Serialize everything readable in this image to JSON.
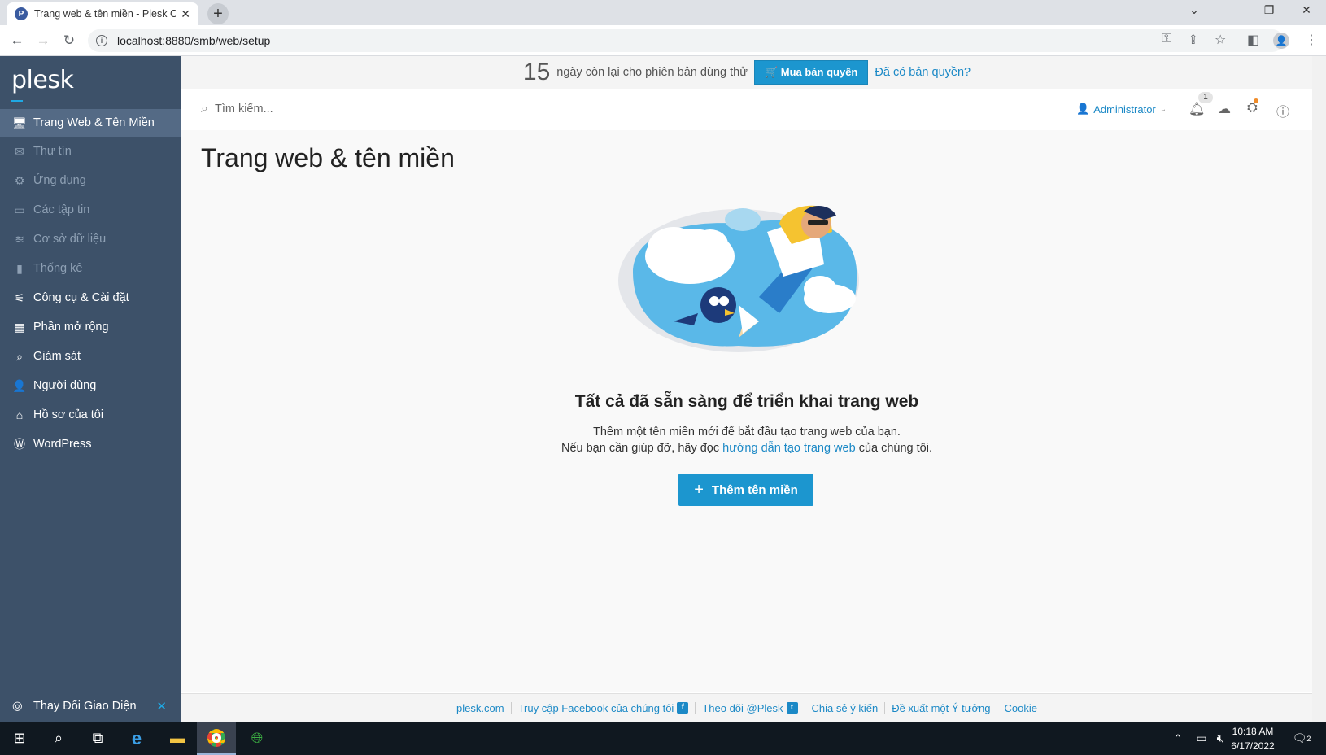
{
  "browser": {
    "tab_title": "Trang web & tên miền - Plesk Ob",
    "url": "localhost:8880/smb/web/setup"
  },
  "trial": {
    "days": "15",
    "text": "ngày còn lại cho phiên bản dùng thử",
    "buy_label": "Mua bản quyền",
    "have_license": "Đã có bản quyền?"
  },
  "logo": "plesk",
  "sidebar": {
    "items": [
      {
        "label": "Trang Web & Tên Miền"
      },
      {
        "label": "Thư tín"
      },
      {
        "label": "Ứng dụng"
      },
      {
        "label": "Các tập tin"
      },
      {
        "label": "Cơ sở dữ liệu"
      },
      {
        "label": "Thống kê"
      },
      {
        "label": "Công cụ & Cài đặt"
      },
      {
        "label": "Phần mở rộng"
      },
      {
        "label": "Giám sát"
      },
      {
        "label": "Người dùng"
      },
      {
        "label": "Hồ sơ của tôi"
      },
      {
        "label": "WordPress"
      }
    ],
    "theme_label": "Thay Đổi Giao Diện"
  },
  "topbar": {
    "search_placeholder": "Tìm kiếm...",
    "user": "Administrator",
    "notification_count": "1"
  },
  "main": {
    "title": "Trang web & tên miền",
    "heading": "Tất cả đã sẵn sàng để triển khai trang web",
    "desc1": "Thêm một tên miền mới để bắt đầu tạo trang web của bạn.",
    "desc2_pre": "Nếu bạn cần giúp đỡ, hãy đọc ",
    "desc2_link": "hướng dẫn tạo trang web",
    "desc2_post": " của chúng tôi.",
    "add_button": "Thêm tên miền"
  },
  "footer": {
    "links": [
      "plesk.com",
      "Truy cập Facebook của chúng tôi",
      "Theo dõi @Plesk",
      "Chia sẻ ý kiến",
      "Đề xuất một Ý tưởng",
      "Cookie"
    ]
  },
  "taskbar": {
    "time": "10:18 AM",
    "date": "6/17/2022",
    "notif_count": "2"
  },
  "colors": {
    "accent": "#1c96cf",
    "sidebar": "#3d5169",
    "link": "#1c89c6"
  }
}
